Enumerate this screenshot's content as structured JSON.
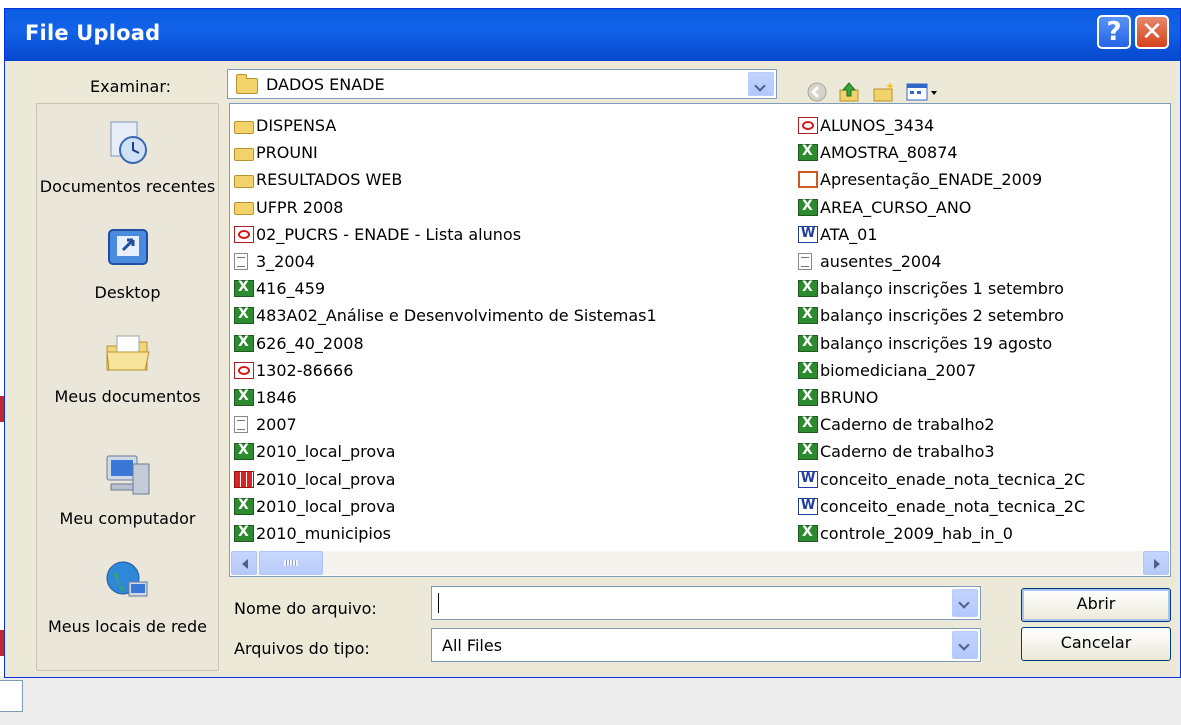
{
  "dialog": {
    "title": "File Upload",
    "help_glyph": "?",
    "close_glyph": "✕"
  },
  "look_in": {
    "label": "Examinar:",
    "value": "DADOS ENADE"
  },
  "places": [
    {
      "label": "Documentos recentes",
      "icon": "recent-documents-icon"
    },
    {
      "label": "Desktop",
      "icon": "desktop-icon"
    },
    {
      "label": "Meus documentos",
      "icon": "my-documents-icon"
    },
    {
      "label": "Meu computador",
      "icon": "my-computer-icon"
    },
    {
      "label": "Meus locais de rede",
      "icon": "network-places-icon"
    }
  ],
  "files_left": [
    {
      "name": "DISPENSA",
      "type": "folder"
    },
    {
      "name": "PROUNI",
      "type": "folder"
    },
    {
      "name": "RESULTADOS WEB",
      "type": "folder"
    },
    {
      "name": "UFPR 2008",
      "type": "folder"
    },
    {
      "name": "02_PUCRS - ENADE - Lista alunos",
      "type": "pdf"
    },
    {
      "name": "3_2004",
      "type": "txt"
    },
    {
      "name": "416_459",
      "type": "xls"
    },
    {
      "name": "483A02_Análise e Desenvolvimento de Sistemas1",
      "type": "xls"
    },
    {
      "name": "626_40_2008",
      "type": "xls"
    },
    {
      "name": "1302-86666",
      "type": "pdf"
    },
    {
      "name": "1846",
      "type": "xls"
    },
    {
      "name": "2007",
      "type": "txt"
    },
    {
      "name": "2010_local_prova",
      "type": "xls"
    },
    {
      "name": "2010_local_prova",
      "type": "grid"
    },
    {
      "name": "2010_local_prova",
      "type": "xls"
    },
    {
      "name": "2010_municipios",
      "type": "xls"
    }
  ],
  "files_right": [
    {
      "name": "ALUNOS_3434",
      "type": "pdf"
    },
    {
      "name": "AMOSTRA_80874",
      "type": "xls"
    },
    {
      "name": "Apresentação_ENADE_2009",
      "type": "ppt"
    },
    {
      "name": "AREA_CURSO_ANO",
      "type": "xls"
    },
    {
      "name": "ATA_01",
      "type": "doc"
    },
    {
      "name": "ausentes_2004",
      "type": "txt"
    },
    {
      "name": "balanço inscrições 1 setembro",
      "type": "xls"
    },
    {
      "name": "balanço inscrições 2 setembro",
      "type": "xls"
    },
    {
      "name": "balanço inscrições 19 agosto",
      "type": "xls"
    },
    {
      "name": "biomediciana_2007",
      "type": "xls"
    },
    {
      "name": "BRUNO",
      "type": "xls"
    },
    {
      "name": "Caderno de trabalho2",
      "type": "xls"
    },
    {
      "name": "Caderno de trabalho3",
      "type": "xls"
    },
    {
      "name": "conceito_enade_nota_tecnica_2C",
      "type": "doc"
    },
    {
      "name": "conceito_enade_nota_tecnica_2C",
      "type": "doc"
    },
    {
      "name": "controle_2009_hab_in_0",
      "type": "xls"
    }
  ],
  "filename": {
    "label": "Nome do arquivo:",
    "value": ""
  },
  "filetype": {
    "label": "Arquivos do tipo:",
    "value": "All Files"
  },
  "buttons": {
    "open": "Abrir",
    "cancel": "Cancelar"
  }
}
